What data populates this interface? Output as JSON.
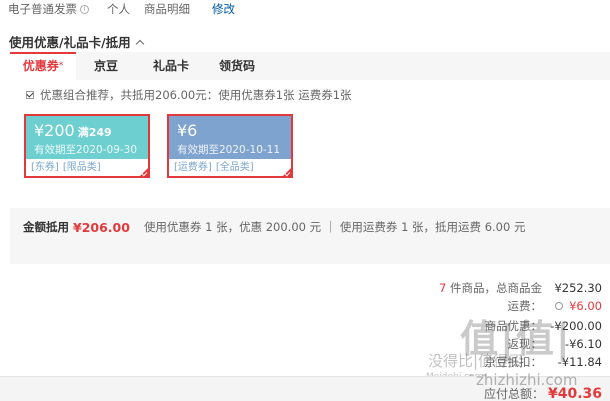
{
  "invoice": {
    "type": "电子普通发票",
    "info_icon": "ⓘ",
    "title": "个人",
    "content": "商品明细",
    "edit": "修改"
  },
  "section": {
    "title": "使用优惠/礼品卡/抵用"
  },
  "tabs": [
    {
      "label": "优惠券",
      "star": "*"
    },
    {
      "label": "京豆"
    },
    {
      "label": "礼品卡"
    },
    {
      "label": "领货码"
    }
  ],
  "combo": {
    "text": "优惠组合推荐，共抵用206.00元：使用优惠券1张 运费券1张"
  },
  "coupons": [
    {
      "amount": "¥200",
      "condition": "满249",
      "validity": "有效期至2020-09-30",
      "tags": [
        "[东券]",
        "[限品类]"
      ],
      "color": "#6dcfd0"
    },
    {
      "amount": "¥6",
      "condition": "",
      "validity": "有效期至2020-10-11",
      "tags": [
        "[运费券]",
        "[全品类]"
      ],
      "color": "#7fa3cf"
    }
  ],
  "summary": {
    "label": "金额抵用",
    "amount": "¥206.00",
    "detail": "使用优惠券 1 张，优惠 200.00 元 ｜ 使用运费券 1 张，抵用运费 6.00 元"
  },
  "totals": {
    "items_count": "7",
    "items_label": " 件商品，总商品金",
    "items_value": "¥252.30",
    "shipping_label": "运费：",
    "shipping_value": "¥6.00",
    "discount_label": "商品优惠：",
    "discount_value": "-¥200.00",
    "row4_label": "返现：",
    "row4_value": "-¥6.10",
    "row5_label": "京豆抵扣：",
    "row5_value": "-¥11.84"
  },
  "payable": {
    "label": "应付总额：",
    "value": "¥40.36"
  },
  "watermark": {
    "main": "值|值|值",
    "cn": "没得比|值得买",
    "en_left": "Meidebi.com",
    "en_right": "zhizhizhi.com"
  },
  "colors": {
    "accent": "#e4393c",
    "link": "#005aa0",
    "coupon_teal": "#6dcfd0",
    "coupon_blue": "#7fa3cf"
  }
}
